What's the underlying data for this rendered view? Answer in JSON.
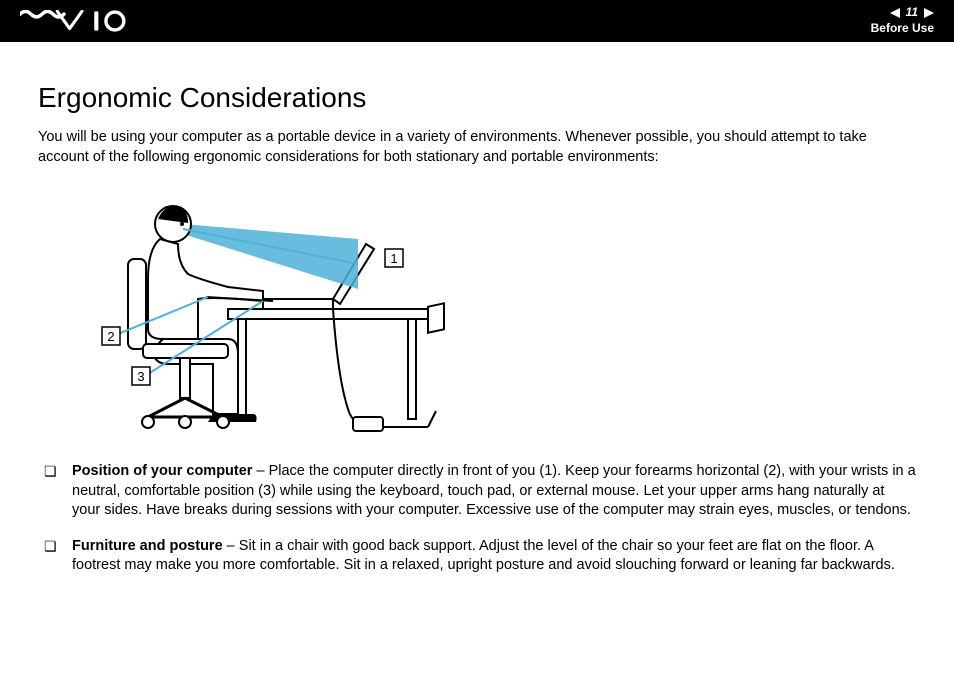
{
  "header": {
    "logo_alt": "VAIO",
    "page_number": "11",
    "section": "Before Use"
  },
  "page": {
    "title": "Ergonomic Considerations",
    "intro": "You will be using your computer as a portable device in a variety of environments. Whenever possible, you should attempt to take account of the following ergonomic considerations for both stationary and portable environments:",
    "callouts": {
      "c1": "1",
      "c2": "2",
      "c3": "3"
    },
    "bullets": [
      {
        "term": "Position of your computer",
        "text": " – Place the computer directly in front of you (1). Keep your forearms horizontal (2), with your wrists in a neutral, comfortable position (3) while using the keyboard, touch pad, or external mouse. Let your upper arms hang naturally at your sides. Have breaks during sessions with your computer. Excessive use of the computer may strain eyes, muscles, or tendons."
      },
      {
        "term": "Furniture and posture",
        "text": " – Sit in a chair with good back support. Adjust the level of the chair so your feet are flat on the floor. A footrest may make you more comfortable. Sit in a relaxed, upright posture and avoid slouching forward or leaning far backwards."
      }
    ]
  }
}
